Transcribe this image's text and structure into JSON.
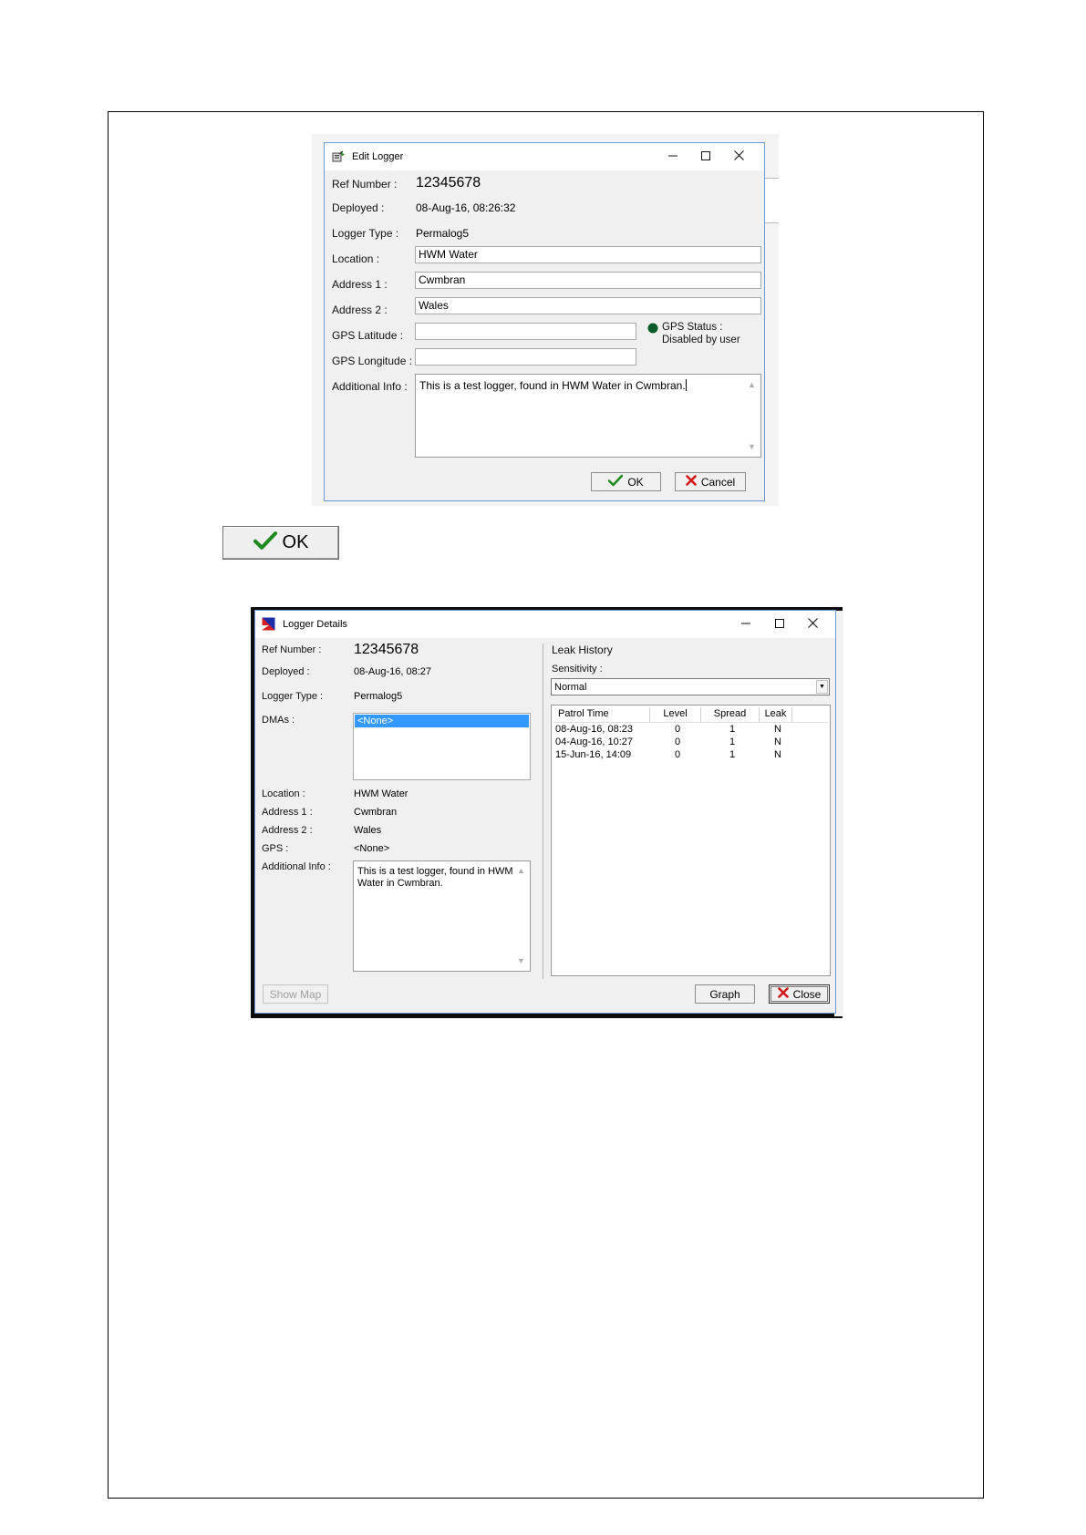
{
  "edit_logger": {
    "title": "Edit Logger",
    "ref_label": "Ref Number :",
    "ref_value": "12345678",
    "deployed_label": "Deployed :",
    "deployed_value": "08-Aug-16, 08:26:32",
    "type_label": "Logger Type :",
    "type_value": "Permalog5",
    "location_label": "Location :",
    "location_value": "HWM Water",
    "address1_label": "Address 1 :",
    "address1_value": "Cwmbran",
    "address2_label": "Address 2 :",
    "address2_value": "Wales",
    "lat_label": "GPS Latitude :",
    "lat_value": "",
    "lon_label": "GPS Longitude :",
    "lon_value": "",
    "gps_status_label": "GPS Status :",
    "gps_status_value": "Disabled by user",
    "gps_status_color": "#0d5a2a",
    "info_label": "Additional Info :",
    "info_value": "This is a test logger, found in HWM Water in Cwmbran.",
    "ok_label": "OK",
    "cancel_label": "Cancel"
  },
  "ok_button_large": {
    "label": "OK"
  },
  "logger_details": {
    "title": "Logger Details",
    "ref_label": "Ref Number :",
    "ref_value": "12345678",
    "deployed_label": "Deployed :",
    "deployed_value": "08-Aug-16, 08:27",
    "type_label": "Logger Type :",
    "type_value": "Permalog5",
    "dmas_label": "DMAs :",
    "dmas_items": [
      "<None>"
    ],
    "location_label": "Location :",
    "location_value": "HWM Water",
    "address1_label": "Address 1 :",
    "address1_value": "Cwmbran",
    "address2_label": "Address 2 :",
    "address2_value": "Wales",
    "gps_label": "GPS :",
    "gps_value": "<None>",
    "info_label": "Additional Info :",
    "info_value": "This is a test logger, found in HWM Water in Cwmbran.",
    "show_map_label": "Show Map",
    "leak_history_title": "Leak History",
    "sensitivity_label": "Sensitivity :",
    "sensitivity_value": "Normal",
    "table": {
      "headers": [
        "Patrol Time",
        "Level",
        "Spread",
        "Leak"
      ],
      "rows": [
        [
          "08-Aug-16, 08:23",
          "0",
          "1",
          "N"
        ],
        [
          "04-Aug-16, 10:27",
          "0",
          "1",
          "N"
        ],
        [
          "15-Jun-16, 14:09",
          "0",
          "1",
          "N"
        ]
      ]
    },
    "graph_label": "Graph",
    "close_label": "Close"
  },
  "colors": {
    "accent_select": "#3399ff",
    "check_green": "#1f8a1f",
    "cancel_red": "#d11a1a"
  }
}
